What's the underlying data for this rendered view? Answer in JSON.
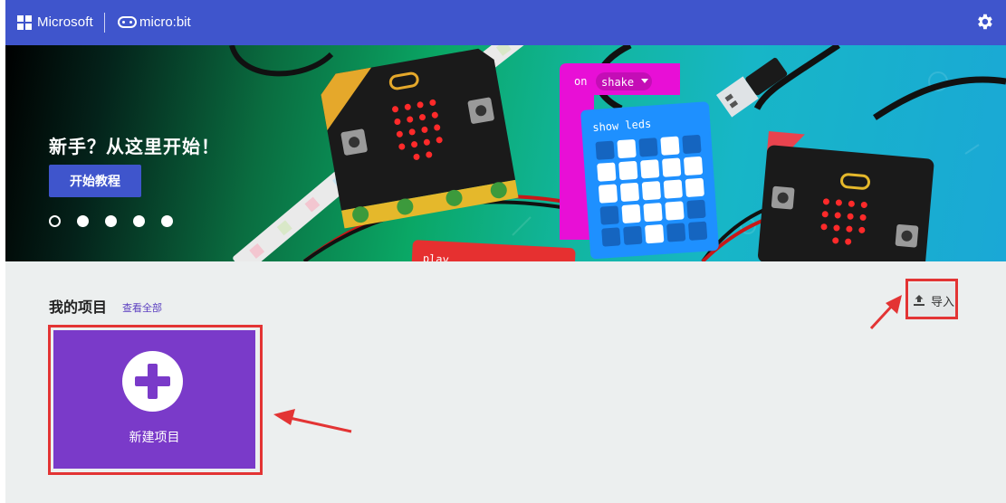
{
  "header": {
    "microsoft_label": "Microsoft",
    "product_label": "micro:bit",
    "settings_icon": "gear-icon"
  },
  "hero": {
    "title": "新手？从这里开始！",
    "cta_label": "开始教程",
    "art": {
      "block_on": "on",
      "block_event": "shake",
      "block_action": "show leds",
      "block_play": "play"
    },
    "carousel": {
      "total": 5,
      "active_index": 1
    }
  },
  "projects": {
    "title": "我的项目",
    "view_all_label": "查看全部",
    "import_label": "导入",
    "import_icon": "upload-icon",
    "new_project_label": "新建项目",
    "new_project_icon": "plus-icon"
  },
  "colors": {
    "header_bg": "#3f55cc",
    "new_project_bg": "#7a3ac9",
    "annotation_red": "#e33434",
    "block_pink": "#e80fd6",
    "block_blue": "#1e90ff"
  }
}
